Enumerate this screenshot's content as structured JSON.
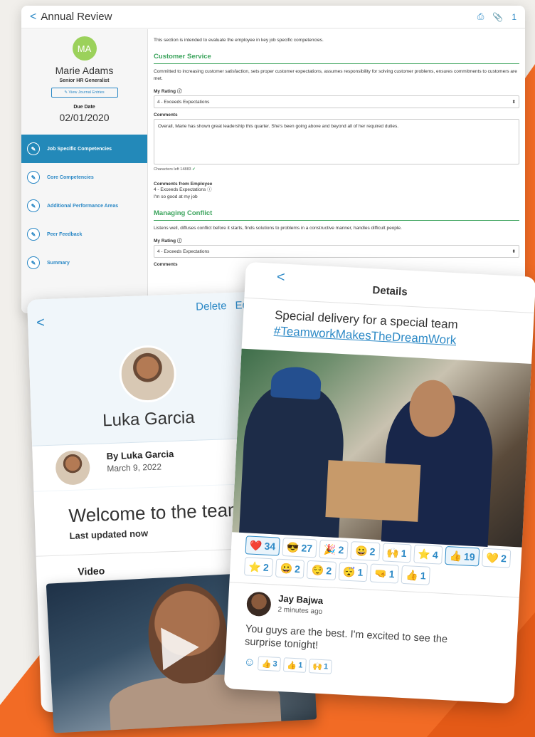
{
  "review": {
    "title": "Annual Review",
    "attachments_count": "1",
    "employee": {
      "initials": "MA",
      "name": "Marie Adams",
      "role": "Senior HR Generalist",
      "journal_button": "View Journal Entries",
      "due_label": "Due Date",
      "due_date": "02/01/2020"
    },
    "nav": [
      {
        "label": "Job Specific Competencies",
        "active": true
      },
      {
        "label": "Core Competencies",
        "active": false
      },
      {
        "label": "Additional Performance Areas",
        "active": false
      },
      {
        "label": "Peer Feedback",
        "active": false
      },
      {
        "label": "Summary",
        "active": false
      }
    ],
    "intro": "This section is intended to evaluate the employee in key job specific competencies.",
    "sections": [
      {
        "title": "Customer Service",
        "description": "Committed to increasing customer satisfaction, sets proper customer expectations, assumes responsibility for solving customer problems, ensures commitments to customers are met.",
        "rating_label": "My Rating",
        "rating_value": "4 - Exceeds Expectations",
        "comments_label": "Comments",
        "comments_value": "Overall, Marie has shown great leadership this quarter. She's been going above and beyond all of her required duties.",
        "chars_left": "Characters left 14883",
        "employee_comments_label": "Comments from Employee",
        "employee_rating": "4 - Exceeds Expectations",
        "employee_comment": "I'm so good at my job"
      },
      {
        "title": "Managing Conflict",
        "description": "Listens well, diffuses conflict before it starts, finds solutions to problems in a constructive manner, handles difficult people.",
        "rating_label": "My Rating",
        "rating_value": "4 - Exceeds Expectations",
        "comments_label": "Comments"
      }
    ]
  },
  "luka": {
    "delete_label": "Delete",
    "edit_label": "Edit",
    "name": "Luka Garcia",
    "byline": "By Luka Garcia",
    "date": "March 9, 2022",
    "welcome": "Welcome to the team",
    "updated": "Last updated now",
    "video_label": "Video"
  },
  "details": {
    "title": "Details",
    "post_text": "Special delivery for a special team",
    "post_tag": "#TeamworkMakesTheDreamWork",
    "reactions": [
      {
        "emoji": "❤️",
        "count": "34",
        "selected": true
      },
      {
        "emoji": "😎",
        "count": "27",
        "selected": false
      },
      {
        "emoji": "🎉",
        "count": "2",
        "selected": false
      },
      {
        "emoji": "😀",
        "count": "2",
        "selected": false
      },
      {
        "emoji": "🙌",
        "count": "1",
        "selected": false
      },
      {
        "emoji": "⭐",
        "count": "4",
        "selected": false
      },
      {
        "emoji": "👍",
        "count": "19",
        "selected": true
      },
      {
        "emoji": "💛",
        "count": "2",
        "selected": false
      },
      {
        "emoji": "⭐",
        "count": "2",
        "selected": false
      },
      {
        "emoji": "😀",
        "count": "2",
        "selected": false
      },
      {
        "emoji": "😌",
        "count": "2",
        "selected": false
      },
      {
        "emoji": "😴",
        "count": "1",
        "selected": false
      },
      {
        "emoji": "🤜",
        "count": "1",
        "selected": false
      },
      {
        "emoji": "👍",
        "count": "1",
        "selected": false
      }
    ],
    "comment": {
      "author": "Jay Bajwa",
      "time": "2 minutes ago",
      "text": "You guys are the best. I'm excited to see the surprise tonight!",
      "reactions": [
        {
          "emoji": "👍",
          "count": "3"
        },
        {
          "emoji": "👍",
          "count": "1"
        },
        {
          "emoji": "🙌",
          "count": "1"
        }
      ]
    }
  },
  "colors": {
    "accent": "#2c89c6",
    "section_green": "#3aa35b",
    "orange": "#f26b25"
  }
}
